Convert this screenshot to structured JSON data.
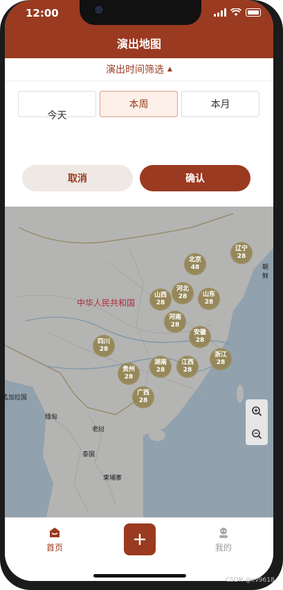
{
  "status": {
    "time": "12:00"
  },
  "header": {
    "title": "演出地图"
  },
  "filter": {
    "label": "演出时间筛选",
    "arrow_icon": "triangle-up-icon"
  },
  "chips": [
    {
      "label": "今天",
      "active": false
    },
    {
      "label": "本周",
      "active": true
    },
    {
      "label": "本月",
      "active": false
    }
  ],
  "actions": {
    "cancel": "取消",
    "confirm": "确认"
  },
  "map": {
    "country_label": "中华人民共和国",
    "clusters": [
      {
        "name": "北京",
        "count": "48"
      },
      {
        "name": "辽宁",
        "count": "28"
      },
      {
        "name": "河北",
        "count": "28"
      },
      {
        "name": "山西",
        "count": "28"
      },
      {
        "name": "山东",
        "count": "28"
      },
      {
        "name": "河南",
        "count": "28"
      },
      {
        "name": "安徽",
        "count": "28"
      },
      {
        "name": "四川",
        "count": "28"
      },
      {
        "name": "浙江",
        "count": "28"
      },
      {
        "name": "贵州",
        "count": "28"
      },
      {
        "name": "湖南",
        "count": "28"
      },
      {
        "name": "江西",
        "count": "28"
      },
      {
        "name": "广西",
        "count": "28"
      }
    ],
    "places": {
      "lao": "老挝",
      "thailand": "泰国",
      "cambodia": "柬埔寨",
      "myanmar": "缅甸",
      "bangladesh": "孟加拉国",
      "korea": "朝鲜"
    },
    "zoom_in_icon": "zoom-in-icon",
    "zoom_out_icon": "zoom-out-icon"
  },
  "tabbar": {
    "home": "首页",
    "mine": "我的"
  },
  "watermark": "CSDN @cv9618",
  "colors": {
    "brand": "#9a3a20",
    "cluster": "#948452",
    "map_overlay": "#7a7a7a"
  }
}
